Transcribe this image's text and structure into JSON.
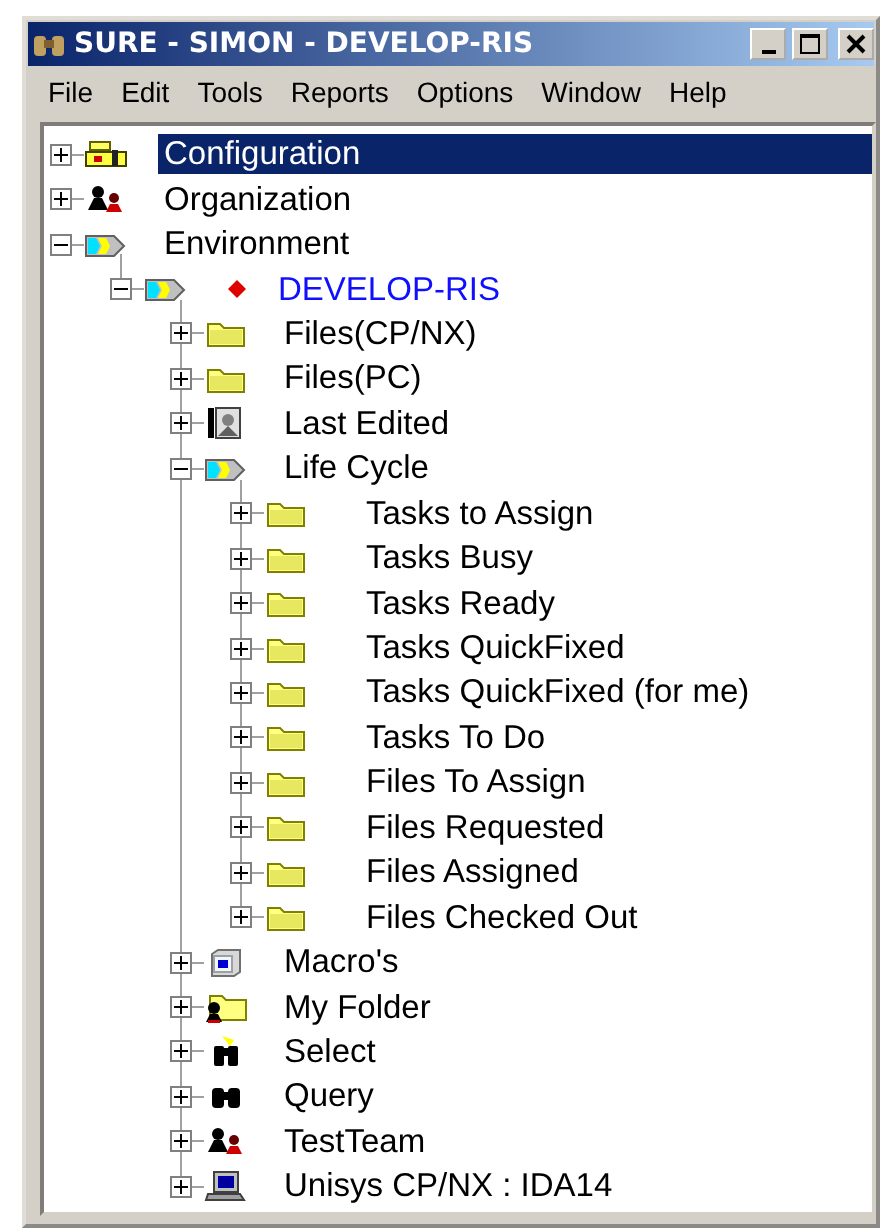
{
  "window": {
    "title": "SURE - SIMON - DEVELOP-RIS"
  },
  "menu": [
    "File",
    "Edit",
    "Tools",
    "Reports",
    "Options",
    "Window",
    "Help"
  ],
  "tree": {
    "items": [
      {
        "label": "Configuration",
        "kind": "config",
        "expanded": false,
        "selected": true
      },
      {
        "label": "Organization",
        "kind": "team",
        "expanded": false,
        "selected": false
      },
      {
        "label": "Environment",
        "kind": "env",
        "expanded": true,
        "selected": false,
        "children": [
          {
            "label": "DEVELOP-RIS",
            "kind": "env",
            "expanded": true,
            "selected": false,
            "current": true,
            "children": [
              {
                "label": "Files(CP/NX)",
                "kind": "folder",
                "expanded": false,
                "selected": false
              },
              {
                "label": "Files(PC)",
                "kind": "folder",
                "expanded": false,
                "selected": false
              },
              {
                "label": "Last Edited",
                "kind": "recent",
                "expanded": false,
                "selected": false
              },
              {
                "label": "Life Cycle",
                "kind": "lifecycle",
                "expanded": true,
                "selected": false,
                "children": [
                  {
                    "label": "Tasks to Assign",
                    "kind": "folder",
                    "expanded": false,
                    "selected": false
                  },
                  {
                    "label": "Tasks Busy",
                    "kind": "folder",
                    "expanded": false,
                    "selected": false
                  },
                  {
                    "label": "Tasks Ready",
                    "kind": "folder",
                    "expanded": false,
                    "selected": false
                  },
                  {
                    "label": "Tasks QuickFixed",
                    "kind": "folder",
                    "expanded": false,
                    "selected": false
                  },
                  {
                    "label": "Tasks QuickFixed (for me)",
                    "kind": "folder",
                    "expanded": false,
                    "selected": false
                  },
                  {
                    "label": "Tasks To Do",
                    "kind": "folder",
                    "expanded": false,
                    "selected": false
                  },
                  {
                    "label": "Files To Assign",
                    "kind": "folder",
                    "expanded": false,
                    "selected": false
                  },
                  {
                    "label": "Files Requested",
                    "kind": "folder",
                    "expanded": false,
                    "selected": false
                  },
                  {
                    "label": "Files Assigned",
                    "kind": "folder",
                    "expanded": false,
                    "selected": false
                  },
                  {
                    "label": "Files Checked Out",
                    "kind": "folder",
                    "expanded": false,
                    "selected": false
                  }
                ]
              },
              {
                "label": "Macro's",
                "kind": "macro",
                "expanded": false,
                "selected": false
              },
              {
                "label": "My Folder",
                "kind": "userfolder",
                "expanded": false,
                "selected": false
              },
              {
                "label": "Select",
                "kind": "select",
                "expanded": false,
                "selected": false
              },
              {
                "label": "Query",
                "kind": "query",
                "expanded": false,
                "selected": false
              },
              {
                "label": "TestTeam",
                "kind": "team",
                "expanded": false,
                "selected": false
              },
              {
                "label": "Unisys CP/NX : IDA14",
                "kind": "terminal",
                "expanded": false,
                "selected": false
              }
            ]
          }
        ]
      }
    ]
  }
}
